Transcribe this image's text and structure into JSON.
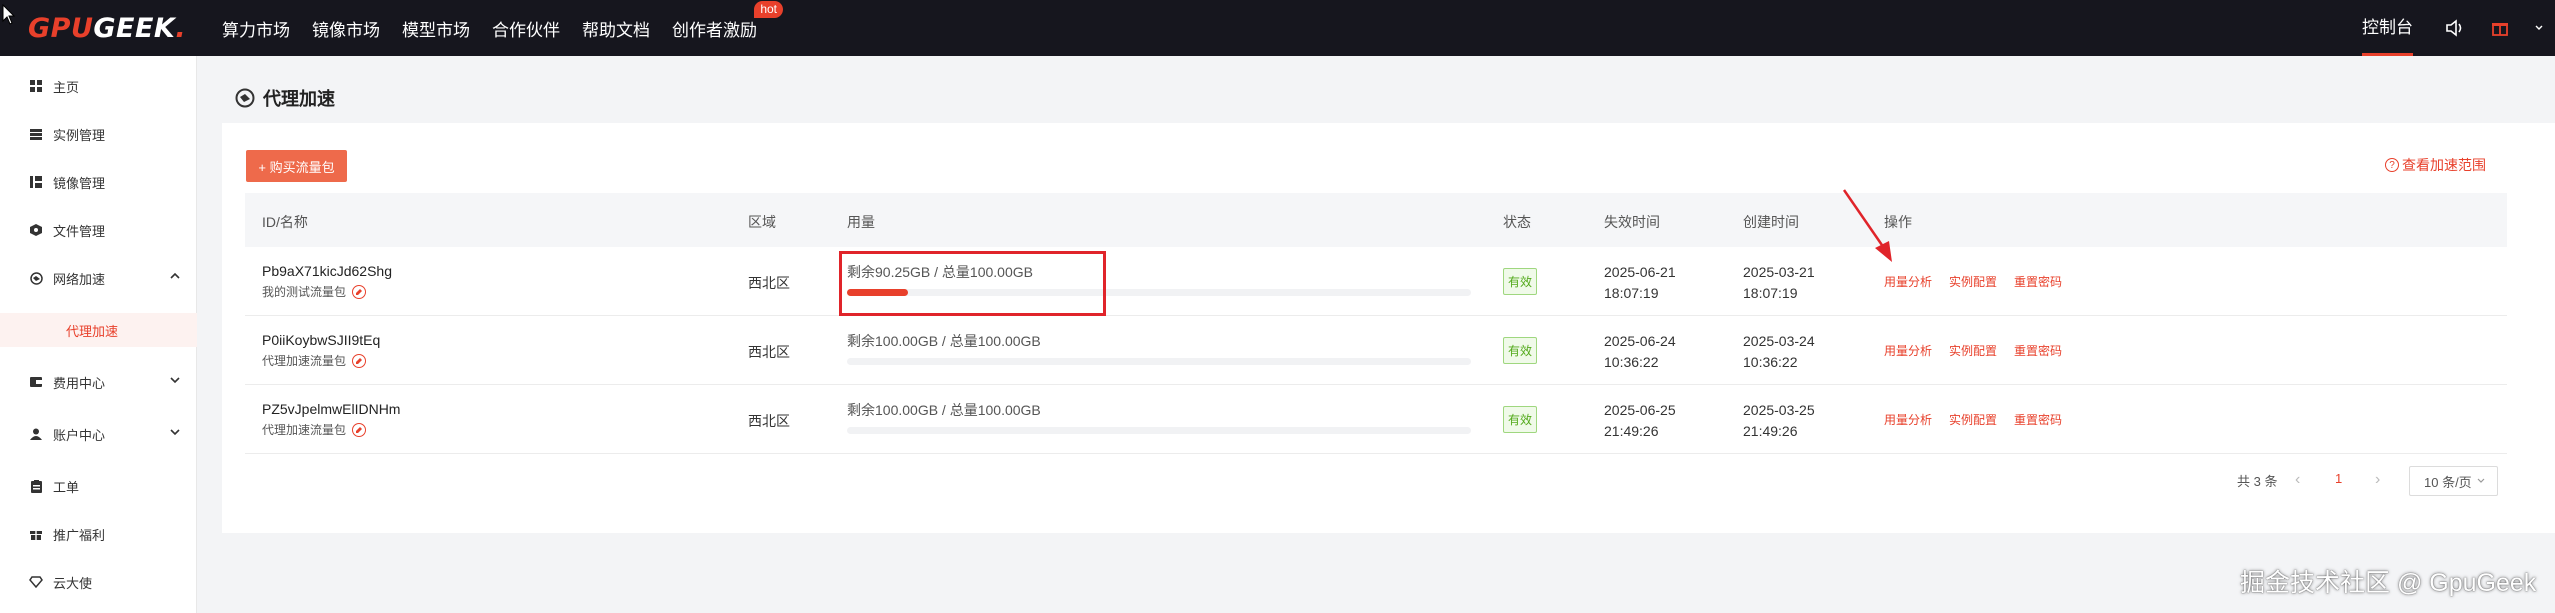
{
  "brand": {
    "logo_gpu": "GPU",
    "logo_geek": "GEEK",
    "logo_dot": ".",
    "accent": "#e8402b",
    "topbar_bg": "#16161e"
  },
  "topnav": {
    "items": [
      "算力市场",
      "镜像市场",
      "模型市场",
      "合作伙伴",
      "帮助文档",
      "创作者激励"
    ],
    "hot_badge": "hot",
    "console": "控制台",
    "icons": [
      "speaker-icon",
      "gift-icon",
      "user-dropdown-icon"
    ]
  },
  "sidebar": {
    "items": [
      {
        "label": "主页",
        "icon": "grid-icon"
      },
      {
        "label": "实例管理",
        "icon": "list-icon"
      },
      {
        "label": "镜像管理",
        "icon": "image-stack-icon"
      },
      {
        "label": "文件管理",
        "icon": "folder-icon"
      },
      {
        "label": "网络加速",
        "icon": "network-icon",
        "expanded": true
      },
      {
        "label": "费用中心",
        "icon": "wallet-icon"
      },
      {
        "label": "账户中心",
        "icon": "user-icon"
      },
      {
        "label": "工单",
        "icon": "ticket-icon"
      },
      {
        "label": "推广福利",
        "icon": "gift-icon"
      },
      {
        "label": "云大使",
        "icon": "diamond-icon"
      }
    ],
    "sub_item": "代理加速"
  },
  "page": {
    "title": "代理加速",
    "buy_button": "+ 购买流量包",
    "range_link": "查看加速范围"
  },
  "table": {
    "headers": [
      "ID/名称",
      "区域",
      "用量",
      "状态",
      "失效时间",
      "创建时间",
      "操作"
    ],
    "rows": [
      {
        "id": "Pb9aX71kicJd62Shg",
        "name": "我的测试流量包",
        "region": "西北区",
        "usage": "剩余90.25GB / 总量100.00GB",
        "used_fraction": 0.0975,
        "status": "有效",
        "expire_date": "2025-06-21",
        "expire_time": "18:07:19",
        "create_date": "2025-03-21",
        "create_time": "18:07:19"
      },
      {
        "id": "P0iiKoybwSJII9tEq",
        "name": "代理加速流量包",
        "region": "西北区",
        "usage": "剩余100.00GB / 总量100.00GB",
        "used_fraction": 0,
        "status": "有效",
        "expire_date": "2025-06-24",
        "expire_time": "10:36:22",
        "create_date": "2025-03-24",
        "create_time": "10:36:22"
      },
      {
        "id": "PZ5vJpelmwElIDNHm",
        "name": "代理加速流量包",
        "region": "西北区",
        "usage": "剩余100.00GB / 总量100.00GB",
        "used_fraction": 0,
        "status": "有效",
        "expire_date": "2025-06-25",
        "expire_time": "21:49:26",
        "create_date": "2025-03-25",
        "create_time": "21:49:26"
      }
    ],
    "actions": [
      "用量分析",
      "实例配置",
      "重置密码"
    ]
  },
  "pagination": {
    "total": "共 3 条",
    "prev": "‹",
    "current": "1",
    "next": "›",
    "page_size": "10 条/页"
  },
  "watermark": "掘金技术社区 @ GpuGeek"
}
